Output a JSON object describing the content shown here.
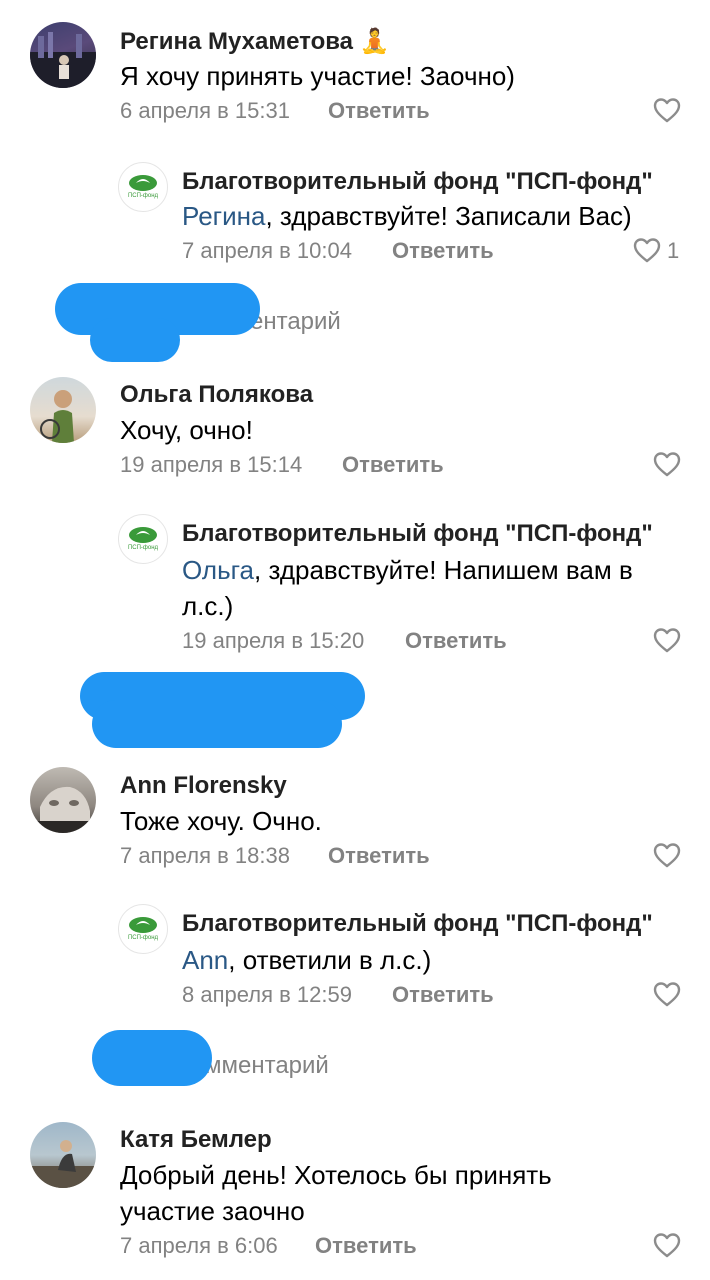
{
  "comments": [
    {
      "author": "Регина Мухаметова",
      "author_emoji": "🧘",
      "text": "Я хочу принять участие! Заочно)",
      "date": "6 апреля в 15:31",
      "reply_label": "Ответить",
      "reply": {
        "author": "Благотворительный фонд \"ПСП-фонд\"",
        "mention": "Регина",
        "text": ", здравствуйте! Записали Вас)",
        "date": "7 апреля в 10:04",
        "reply_label": "Ответить",
        "likes": "1"
      },
      "collapsed_label": "ентарий"
    },
    {
      "author": "Ольга Полякова",
      "text": "Хочу, очно!",
      "date": "19 апреля в 15:14",
      "reply_label": "Ответить",
      "reply": {
        "author": "Благотворительный фонд \"ПСП-фонд\"",
        "mention": "Ольга",
        "text_line1": ", здравствуйте! Напишем вам в",
        "text_line2": "л.с.)",
        "date": "19 апреля в 15:20",
        "reply_label": "Ответить"
      }
    },
    {
      "author": "Ann Florensky",
      "text": "Тоже хочу. Очно.",
      "date": "7 апреля в 18:38",
      "reply_label": "Ответить",
      "reply": {
        "author": "Благотворительный фонд \"ПСП-фонд\"",
        "mention": "Ann",
        "text": ", ответили в л.с.)",
        "date": "8 апреля в 12:59",
        "reply_label": "Ответить"
      },
      "collapsed_label": "мментарий"
    },
    {
      "author": "Катя Бемлер",
      "text_line1": "Добрый день! Хотелось бы принять",
      "text_line2": "участие заочно",
      "date": "7 апреля в 6:06",
      "reply_label": "Ответить"
    }
  ],
  "fund_logo_text": "ПСП-фонд",
  "icons": {
    "like": "heart-outline-icon"
  },
  "colors": {
    "link": "#2a5885",
    "meta": "#828282",
    "redaction": "#2196f3",
    "logo_green": "#3a9a3a"
  }
}
